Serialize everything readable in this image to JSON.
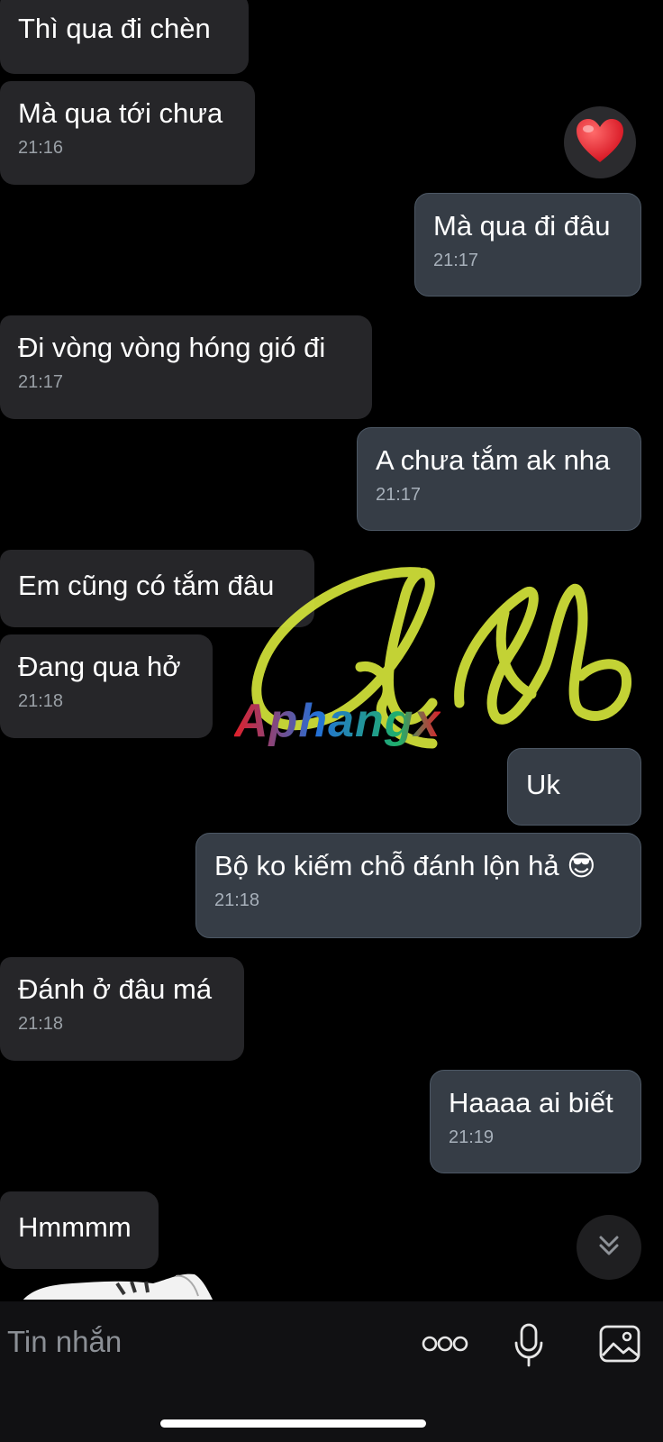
{
  "messages": [
    {
      "dir": "in",
      "text": "Thì qua đi chèn",
      "time": ""
    },
    {
      "dir": "in",
      "text": "Mà qua tới chưa",
      "time": "21:16"
    },
    {
      "dir": "out",
      "text": "Mà qua đi đâu",
      "time": "21:17"
    },
    {
      "dir": "in",
      "text": "Đi vòng vòng hóng gió đi",
      "time": "21:17"
    },
    {
      "dir": "out",
      "text": "A chưa tắm ak nha",
      "time": "21:17"
    },
    {
      "dir": "in",
      "text": "Em cũng có tắm đâu",
      "time": ""
    },
    {
      "dir": "in",
      "text": "Đang qua hở",
      "time": "21:18"
    },
    {
      "dir": "out",
      "text": "Uk",
      "time": ""
    },
    {
      "dir": "out",
      "text": "Bộ ko kiếm chỗ đánh lộn hả 😎",
      "time": "21:18"
    },
    {
      "dir": "in",
      "text": "Đánh ở đâu má",
      "time": "21:18"
    },
    {
      "dir": "out",
      "text": "Haaaa ai biết",
      "time": "21:19"
    },
    {
      "dir": "in",
      "text": "Hmmmm",
      "time": ""
    }
  ],
  "reaction": {
    "emoji": "❤️",
    "icon": "heart-icon"
  },
  "watermark": {
    "text": "Aphangx"
  },
  "composer": {
    "placeholder": "Tin nhắn",
    "more_icon": "more-dots-icon",
    "mic_icon": "microphone-icon",
    "image_icon": "image-icon"
  },
  "scroll_down_icon": "chevron-double-down-icon",
  "colors": {
    "background": "#000000",
    "incoming_bubble": "#262629",
    "outgoing_bubble": "#363d46",
    "scribble": "#d4e43a"
  }
}
